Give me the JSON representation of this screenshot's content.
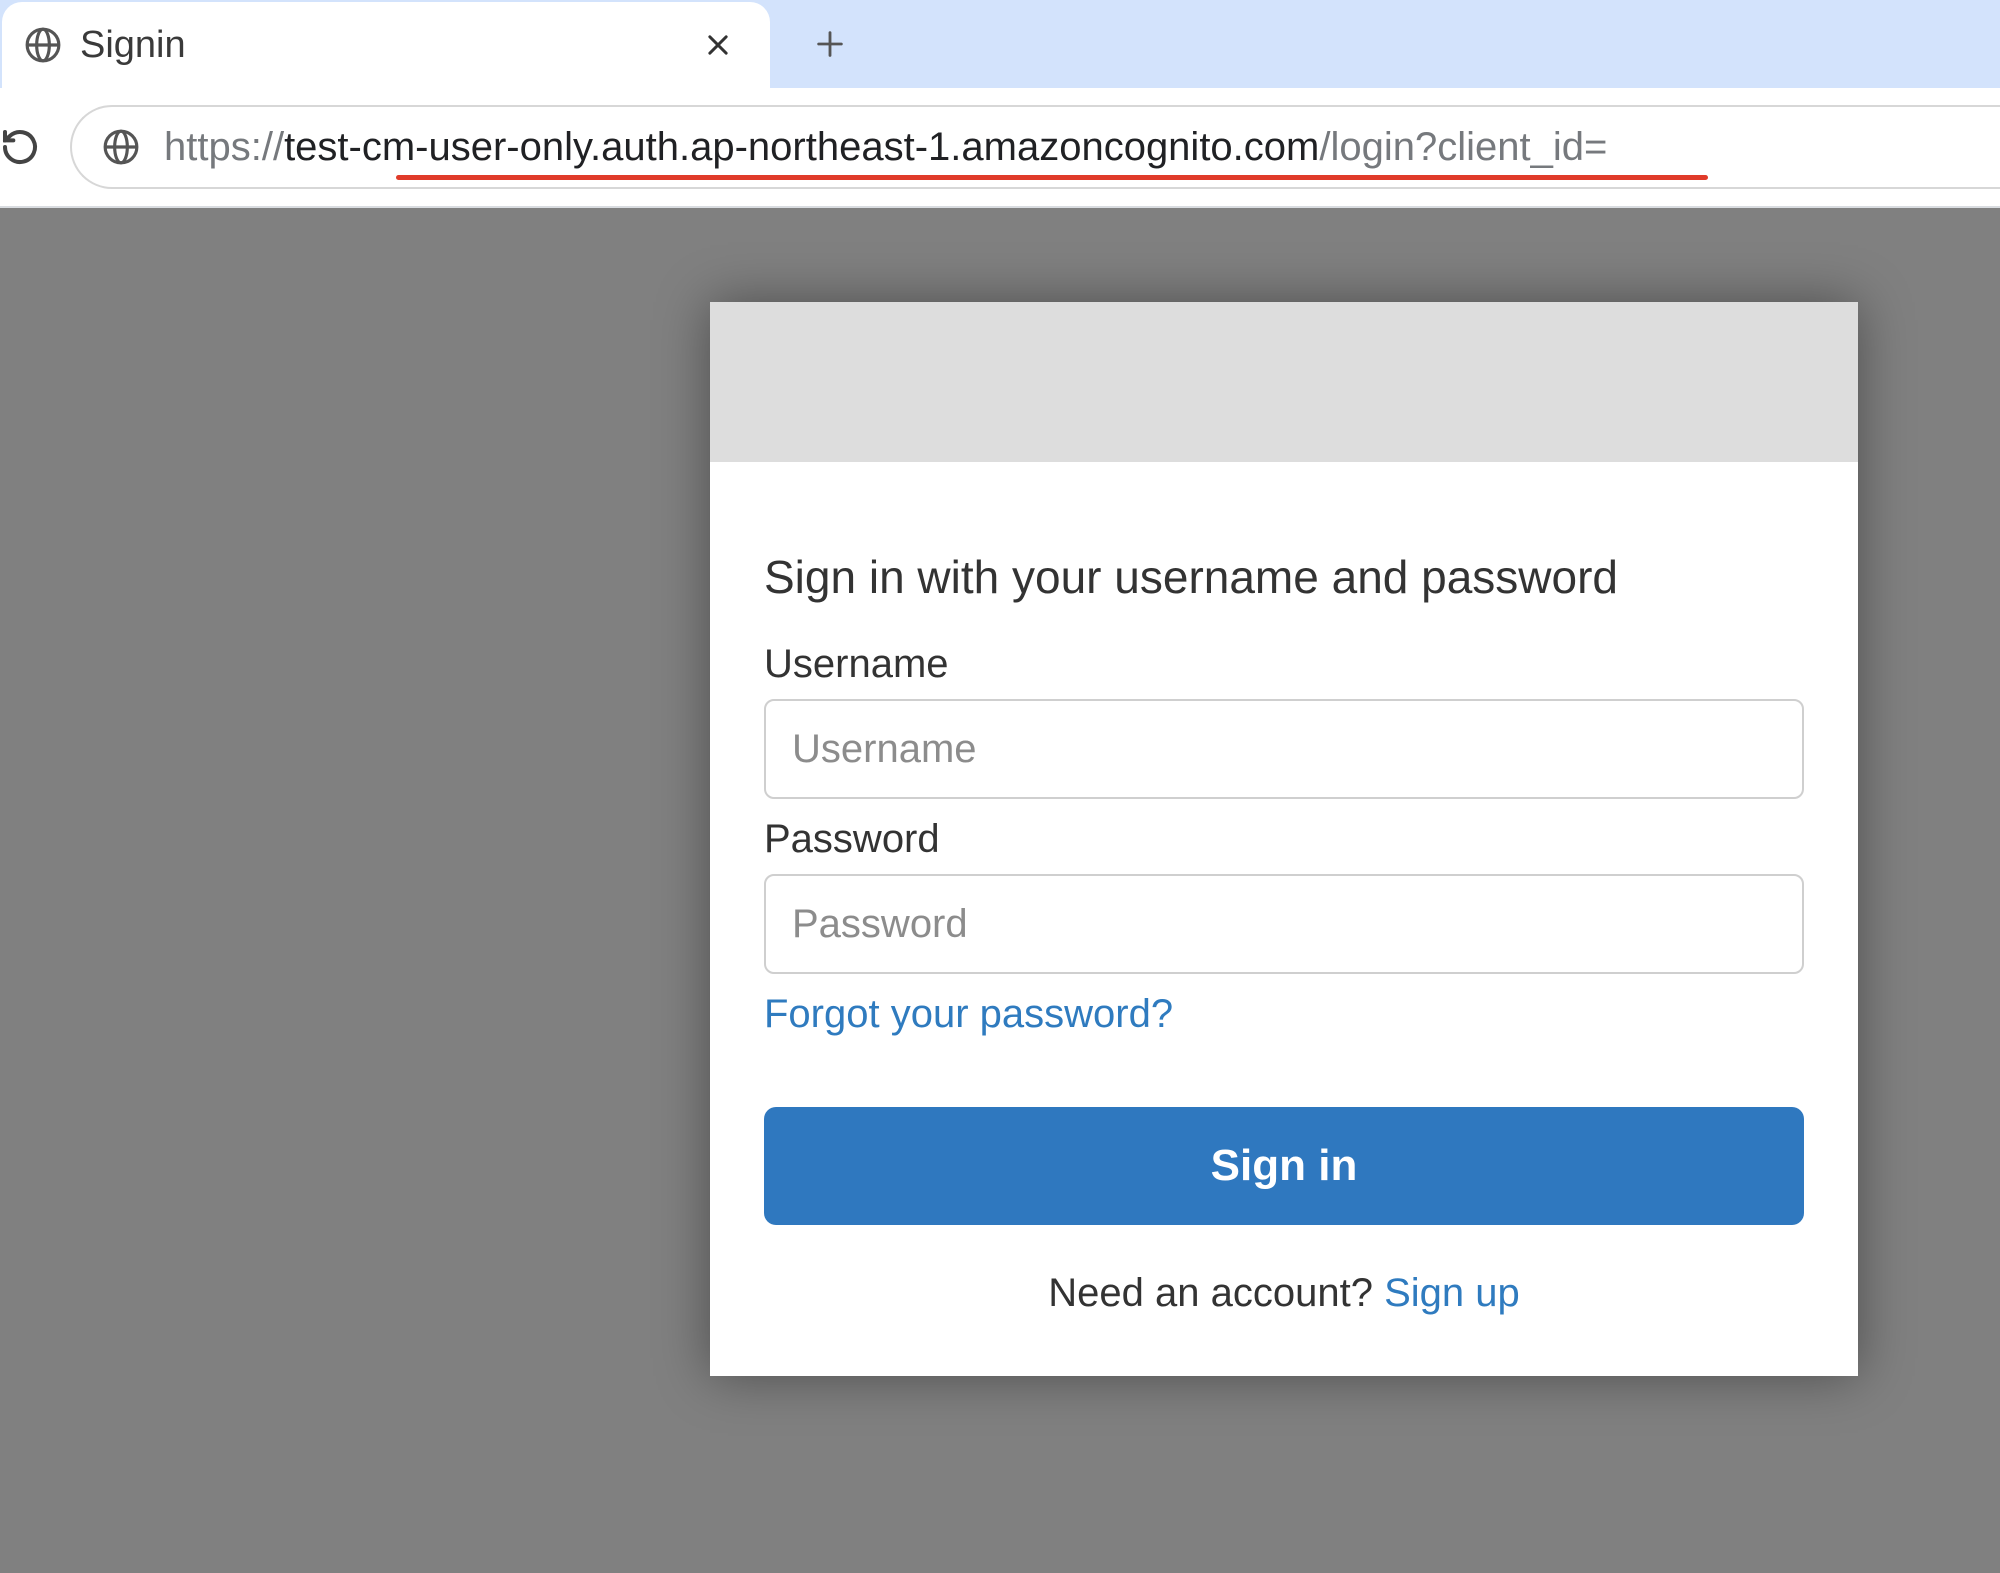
{
  "browser": {
    "tab_title": "Signin",
    "url_scheme": "https://",
    "url_domain": "test-cm-user-only.auth.ap-northeast-1.amazoncognito.com",
    "url_path": "/login?client_id="
  },
  "signin": {
    "heading": "Sign in with your username and password",
    "username_label": "Username",
    "username_placeholder": "Username",
    "password_label": "Password",
    "password_placeholder": "Password",
    "forgot_link": "Forgot your password?",
    "submit_label": "Sign in",
    "need_account_text": "Need an account? ",
    "signup_link": "Sign up"
  }
}
